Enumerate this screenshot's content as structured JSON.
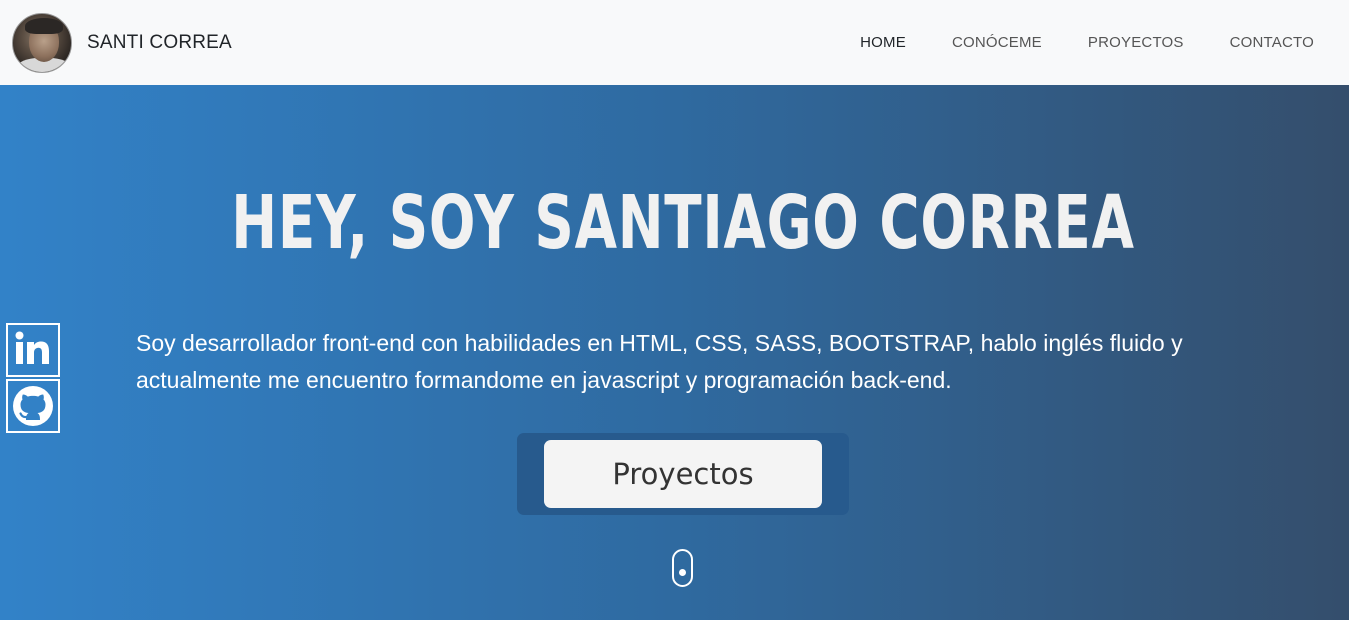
{
  "navbar": {
    "brand_name": "SANTI CORREA",
    "links": [
      {
        "label": "HOME",
        "active": true
      },
      {
        "label": "CONÓCEME",
        "active": false
      },
      {
        "label": "PROYECTOS",
        "active": false
      },
      {
        "label": "CONTACTO",
        "active": false
      }
    ]
  },
  "hero": {
    "title": "HEY, SOY SANTIAGO CORREA",
    "description_line1": "Soy desarrollador front-end con habilidades en HTML, CSS, SASS, BOOTSTRAP, hablo inglés fluido y",
    "description_line2": "actualmente me encuentro formandome en javascript y programación back-end.",
    "cta_label": "Proyectos"
  },
  "social": [
    {
      "icon": "linkedin-icon"
    },
    {
      "icon": "github-icon"
    }
  ],
  "colors": {
    "navbar_bg": "#f8f9fa",
    "hero_gradient_start": "#3282c8",
    "hero_gradient_end": "#344e6c",
    "cta_bg": "#f4f4f4",
    "cta_frame": "#275a8d"
  }
}
